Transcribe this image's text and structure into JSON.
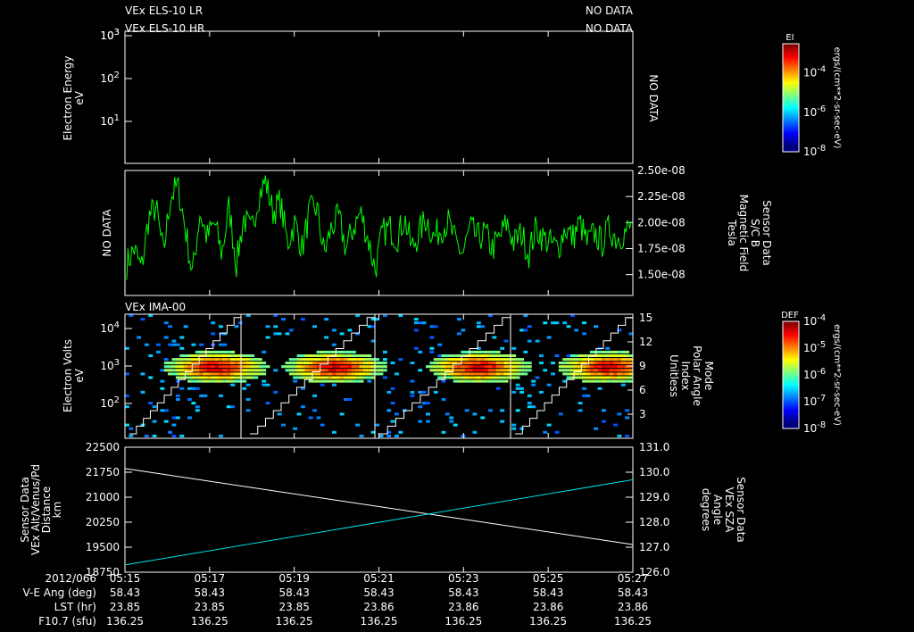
{
  "header": {
    "left1": "VEx ELS-10 LR",
    "left2": "VEx ELS-10 HR",
    "right1": "NO DATA",
    "right2": "NO DATA"
  },
  "chart_data": [
    {
      "type": "heatmap",
      "id": "els",
      "ylabel": "Electron Energy",
      "yunit": "eV",
      "yticks": [
        "10^1",
        "10^2",
        "10^3"
      ],
      "status": "NO DATA",
      "colorbar": {
        "title": "EI",
        "ticks": [
          "10^-4",
          "10^-6",
          "10^-8"
        ],
        "unit": "ergs/(cm**2-sr-sec-eV)"
      }
    },
    {
      "type": "line",
      "id": "mag",
      "left_status": "NO DATA",
      "ylabel_lines": [
        "Sensor Data",
        "S/C B",
        "Magnetic Field",
        "Tesla"
      ],
      "yticks": [
        "1.50e-08",
        "1.75e-08",
        "2.00e-08",
        "2.25e-08",
        "2.50e-08"
      ],
      "ylim": [
        1.3e-08,
        2.5e-08
      ],
      "color": "#00ff00",
      "values": [
        1.6,
        1.75,
        1.55,
        2.05,
        2.15,
        1.7,
        2.25,
        2.35,
        1.95,
        1.5,
        2.1,
        1.85,
        2.0,
        1.7,
        2.15,
        1.6,
        2.05,
        1.9,
        2.25,
        2.4,
        2.1,
        2.2,
        1.8,
        2.0,
        1.75,
        2.1,
        2.15,
        1.7,
        1.95,
        2.05,
        1.75,
        1.95,
        2.1,
        1.85,
        1.55,
        1.9,
        1.95,
        1.85,
        2.05,
        1.75,
        1.9,
        2.05,
        1.85,
        1.95,
        2.0,
        1.8,
        1.7,
        1.95,
        1.85,
        1.9,
        1.75,
        1.85,
        2.0,
        1.8,
        1.9,
        1.7,
        1.95,
        1.85,
        1.8,
        1.75,
        1.95,
        1.85,
        2.0,
        1.8,
        1.9,
        1.8,
        1.95,
        1.85,
        1.9,
        1.95
      ]
    },
    {
      "type": "heatmap",
      "id": "ima",
      "title": "VEx IMA-00",
      "ylabel": "Electron Volts",
      "yunit": "eV",
      "yticks": [
        "10^2",
        "10^3",
        "10^4"
      ],
      "right_label_lines": [
        "Mode",
        "Polar Angle",
        "Index",
        "Unitless"
      ],
      "right_ticks": [
        3,
        6,
        9,
        12,
        15
      ],
      "colorbar": {
        "title": "DEF",
        "ticks": [
          "10^-4",
          "10^-5",
          "10^-6",
          "10^-7",
          "10^-8"
        ],
        "unit": "ergs/(cm**2-sr-sec-eV)"
      }
    },
    {
      "type": "line",
      "id": "geo",
      "ylabel_lines": [
        "Sensor Data",
        "VEx Alt/Venus/Pd",
        "Distance",
        "km"
      ],
      "yticks": [
        "18750",
        "19500",
        "20250",
        "21000",
        "21750",
        "22500"
      ],
      "ylim": [
        18750,
        22500
      ],
      "right_label_lines": [
        "Sensor Data",
        "VEx SZA",
        "Angle",
        "degrees"
      ],
      "right_ticks": [
        "126.0",
        "127.0",
        "128.0",
        "129.0",
        "130.0",
        "131.0"
      ],
      "rlim": [
        126,
        131
      ],
      "series": [
        {
          "name": "Distance",
          "color": "#ffffff",
          "start": 21860,
          "end": 19580
        },
        {
          "name": "SZA",
          "color": "#00e0e0",
          "start": 126.29,
          "end": 129.7
        }
      ]
    }
  ],
  "footer": {
    "rows": [
      {
        "label": "2012/066",
        "values": [
          "05:15",
          "05:17",
          "05:19",
          "05:21",
          "05:23",
          "05:25",
          "05:27"
        ]
      },
      {
        "label": "V-E Ang (deg)",
        "values": [
          "58.43",
          "58.43",
          "58.43",
          "58.43",
          "58.43",
          "58.43",
          "58.43"
        ]
      },
      {
        "label": "LST (hr)",
        "values": [
          "23.85",
          "23.85",
          "23.85",
          "23.86",
          "23.86",
          "23.86",
          "23.86"
        ]
      },
      {
        "label": "F10.7 (sfu)",
        "values": [
          "136.25",
          "136.25",
          "136.25",
          "136.25",
          "136.25",
          "136.25",
          "136.25"
        ]
      }
    ]
  }
}
